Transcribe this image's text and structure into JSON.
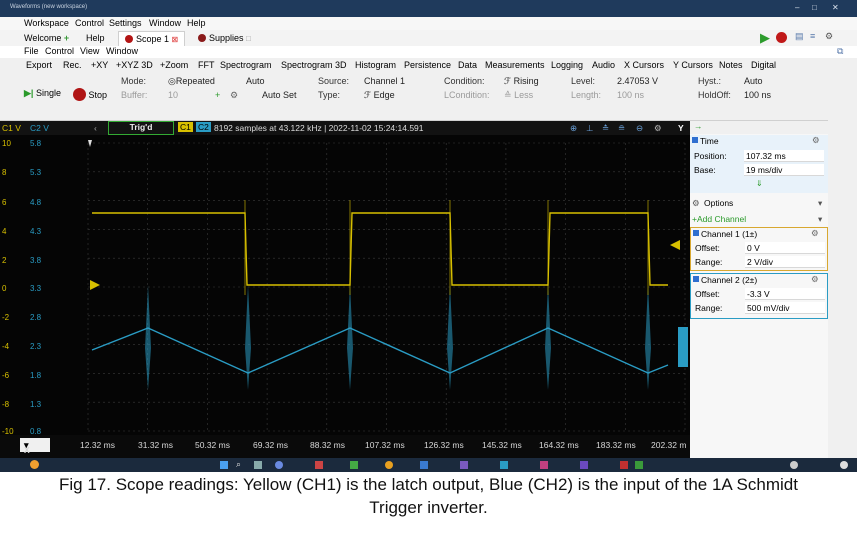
{
  "window": {
    "title": "Waveforms (new workspace)"
  },
  "menubar": [
    "Workspace",
    "Control",
    "Settings",
    "Window",
    "Help"
  ],
  "tabs": [
    {
      "label": "Welcome",
      "icon": "plus-icon"
    },
    {
      "label": "Help"
    },
    {
      "label": "Scope 1",
      "icon": "record-dot-icon",
      "active": true
    },
    {
      "label": "Supplies",
      "icon": "record-dot-icon"
    }
  ],
  "submenu": [
    "File",
    "Control",
    "View",
    "Window"
  ],
  "toolbar": [
    "Export",
    "Rec.",
    "+XY",
    "+XYZ 3D",
    "+Zoom",
    "FFT",
    "Spectrogram",
    "Spectrogram 3D",
    "Histogram",
    "Persistence",
    "Data",
    "Measurements",
    "Logging",
    "Audio",
    "X Cursors",
    "Y Cursors",
    "Notes",
    "Digital"
  ],
  "controls": {
    "single": "Single",
    "stop": "Stop",
    "mode_label": "Mode:",
    "mode_value": "Repeated",
    "buffer_label": "Buffer:",
    "buffer_value": "10",
    "auto": "Auto",
    "auto_set": "Auto Set",
    "source_label": "Source:",
    "source_value": "Channel 1",
    "type_label": "Type:",
    "type_value": "Edge",
    "condition_label": "Condition:",
    "condition_value": "Rising",
    "lcondition_label": "LCondition:",
    "lcondition_value": "Less",
    "level_label": "Level:",
    "level_value": "2.47053 V",
    "length_label": "Length:",
    "length_value": "100 ns",
    "hyst_label": "Hyst.:",
    "hyst_value": "Auto",
    "holdoff_label": "HoldOff:",
    "holdoff_value": "100 ns"
  },
  "scope_header": {
    "ch1_unit": "C1 V",
    "ch2_unit": "C2 V",
    "status": "Trig'd",
    "c1": "C1",
    "c2": "C2",
    "info": "8192 samples at 43.122 kHz | 2022-11-02 15:24:14.591"
  },
  "y_axis_ch1": [
    "10",
    "8",
    "6",
    "4",
    "2",
    "0",
    "-2",
    "-4",
    "-6",
    "-8",
    "-10"
  ],
  "y_axis_ch2": [
    "5.8",
    "5.3",
    "4.8",
    "4.3",
    "3.8",
    "3.3",
    "2.8",
    "2.3",
    "1.8",
    "1.3",
    "0.8"
  ],
  "x_axis": [
    "12.32 ms",
    "31.32 ms",
    "50.32 ms",
    "69.32 ms",
    "88.32 ms",
    "107.32 ms",
    "126.32 ms",
    "145.32 ms",
    "164.32 ms",
    "183.32 ms",
    "202.32 m"
  ],
  "x_button": "X",
  "side_panel": {
    "time_title": "Time",
    "position_label": "Position:",
    "position_value": "107.32 ms",
    "base_label": "Base:",
    "base_value": "19 ms/div",
    "options": "Options",
    "add_channel": "+Add Channel",
    "ch1_title": "Channel 1 (1±)",
    "ch1_offset_label": "Offset:",
    "ch1_offset_value": "0 V",
    "ch1_range_label": "Range:",
    "ch1_range_value": "2 V/div",
    "ch2_title": "Channel 2 (2±)",
    "ch2_offset_label": "Offset:",
    "ch2_offset_value": "-3.3 V",
    "ch2_range_label": "Range:",
    "ch2_range_value": "500 mV/div"
  },
  "colors": {
    "ch1": "#d8c000",
    "ch2": "#2a9cc4",
    "bg": "#050505"
  },
  "caption": {
    "line1": "Fig 17. Scope readings: Yellow (CH1) is the latch output, Blue (CH2) is the input of the 1A Schmidt",
    "line2": "Trigger inverter."
  }
}
